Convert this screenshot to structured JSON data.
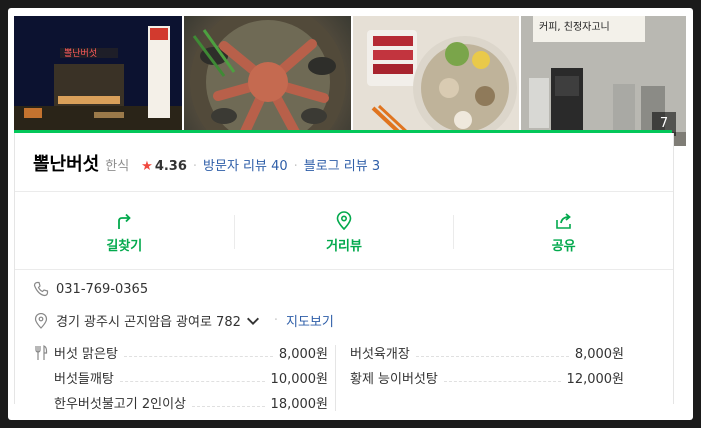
{
  "photos": {
    "count_badge": "7",
    "items": [
      {
        "name": "photo-exterior",
        "sign_text": "뽈난버섯"
      },
      {
        "name": "photo-octopus-stew"
      },
      {
        "name": "photo-hotpot-platter"
      },
      {
        "name": "photo-interior-sign",
        "sign_text": "커피, 친정자고니"
      }
    ]
  },
  "place": {
    "name": "뽈난버섯",
    "category": "한식",
    "rating": "4.36",
    "visitor_reviews": "방문자 리뷰 40",
    "blog_reviews": "블로그 리뷰 3"
  },
  "actions": [
    {
      "label": "길찾기",
      "icon": "directions-icon"
    },
    {
      "label": "거리뷰",
      "icon": "location-pin-icon"
    },
    {
      "label": "공유",
      "icon": "share-icon"
    }
  ],
  "info": {
    "phone": "031-769-0365",
    "address": "경기 광주시 곤지암읍 광여로 782",
    "map_link": "지도보기"
  },
  "menu": [
    {
      "name": "버섯 맑은탕",
      "price": "8,000원"
    },
    {
      "name": "버섯육개장",
      "price": "8,000원"
    },
    {
      "name": "버섯들깨탕",
      "price": "10,000원"
    },
    {
      "name": "황제 능이버섯탕",
      "price": "12,000원"
    },
    {
      "name": "한우버섯불고기 2인이상",
      "price": "18,000원"
    }
  ],
  "colors": {
    "accent": "#03c75a",
    "star": "#f0483e",
    "link": "#2e5ea8"
  }
}
